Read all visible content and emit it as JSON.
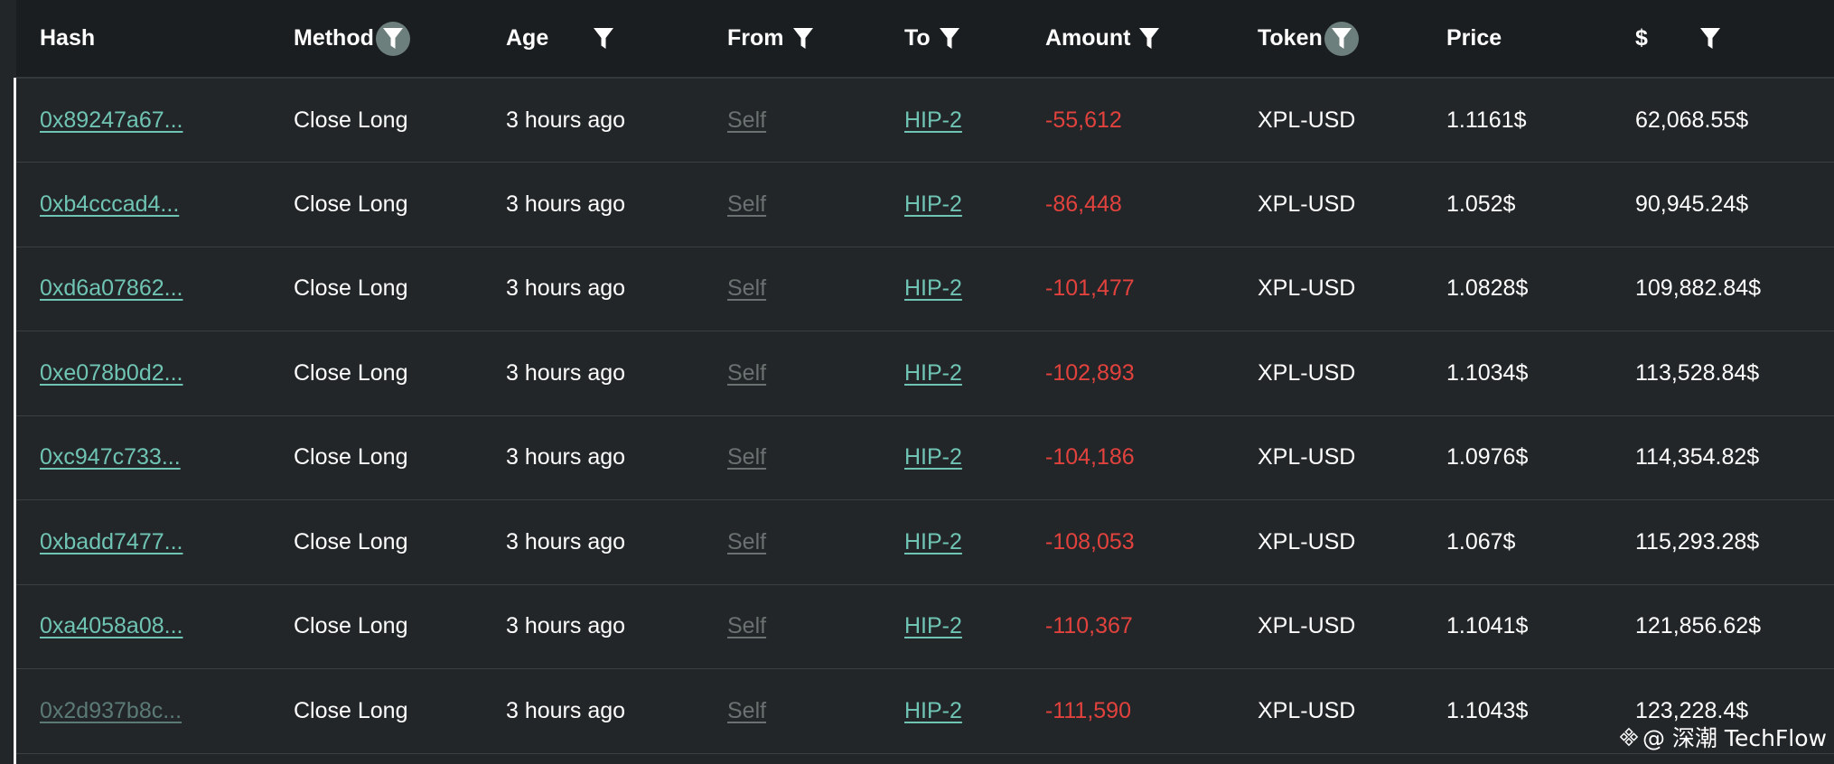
{
  "columns": {
    "hash": "Hash",
    "method": "Method",
    "age": "Age",
    "from": "From",
    "to": "To",
    "amount": "Amount",
    "token": "Token",
    "price": "Price",
    "usd": "$"
  },
  "rows": [
    {
      "hash": "0xb4cccad4...",
      "method": "Close Long",
      "age": "3 hours ago",
      "from": "Self",
      "to": "HIP-2",
      "amount": "-86,448",
      "token": "XPL-USD",
      "price": "1.052$",
      "usd": "90,945.24$"
    },
    {
      "hash": "0xd6a07862...",
      "method": "Close Long",
      "age": "3 hours ago",
      "from": "Self",
      "to": "HIP-2",
      "amount": "-101,477",
      "token": "XPL-USD",
      "price": "1.0828$",
      "usd": "109,882.84$"
    },
    {
      "hash": "0xe078b0d2...",
      "method": "Close Long",
      "age": "3 hours ago",
      "from": "Self",
      "to": "HIP-2",
      "amount": "-102,893",
      "token": "XPL-USD",
      "price": "1.1034$",
      "usd": "113,528.84$"
    },
    {
      "hash": "0xc947c733...",
      "method": "Close Long",
      "age": "3 hours ago",
      "from": "Self",
      "to": "HIP-2",
      "amount": "-104,186",
      "token": "XPL-USD",
      "price": "1.0976$",
      "usd": "114,354.82$"
    },
    {
      "hash": "0xbadd7477...",
      "method": "Close Long",
      "age": "3 hours ago",
      "from": "Self",
      "to": "HIP-2",
      "amount": "-108,053",
      "token": "XPL-USD",
      "price": "1.067$",
      "usd": "115,293.28$"
    },
    {
      "hash": "0xa4058a08...",
      "method": "Close Long",
      "age": "3 hours ago",
      "from": "Self",
      "to": "HIP-2",
      "amount": "-110,367",
      "token": "XPL-USD",
      "price": "1.1041$",
      "usd": "121,856.62$"
    },
    {
      "hash": "0x2d937b8c...",
      "method": "Close Long",
      "age": "3 hours ago",
      "from": "Self",
      "to": "HIP-2",
      "amount": "-111,590",
      "token": "XPL-USD",
      "price": "1.1043$",
      "usd": "123,228.4$"
    }
  ],
  "first_row": {
    "hash": "0x89247a67...",
    "method": "Close Long",
    "age": "3 hours ago",
    "from": "Self",
    "to": "HIP-2",
    "amount": "-55,612",
    "token": "XPL-USD",
    "price": "1.1161$",
    "usd": "62,068.55$"
  },
  "watermark": {
    "text": "@ 深潮 TechFlow"
  },
  "colors": {
    "background": "#222628",
    "header_background": "#1b1e20",
    "link": "#6fc4b4",
    "muted_link": "#6a7170",
    "negative_amount": "#e2423d",
    "filter_badge": "#6c7f7c"
  },
  "icons": {
    "filter": "filter-icon",
    "watermark_logo": "binance-logo-icon"
  }
}
